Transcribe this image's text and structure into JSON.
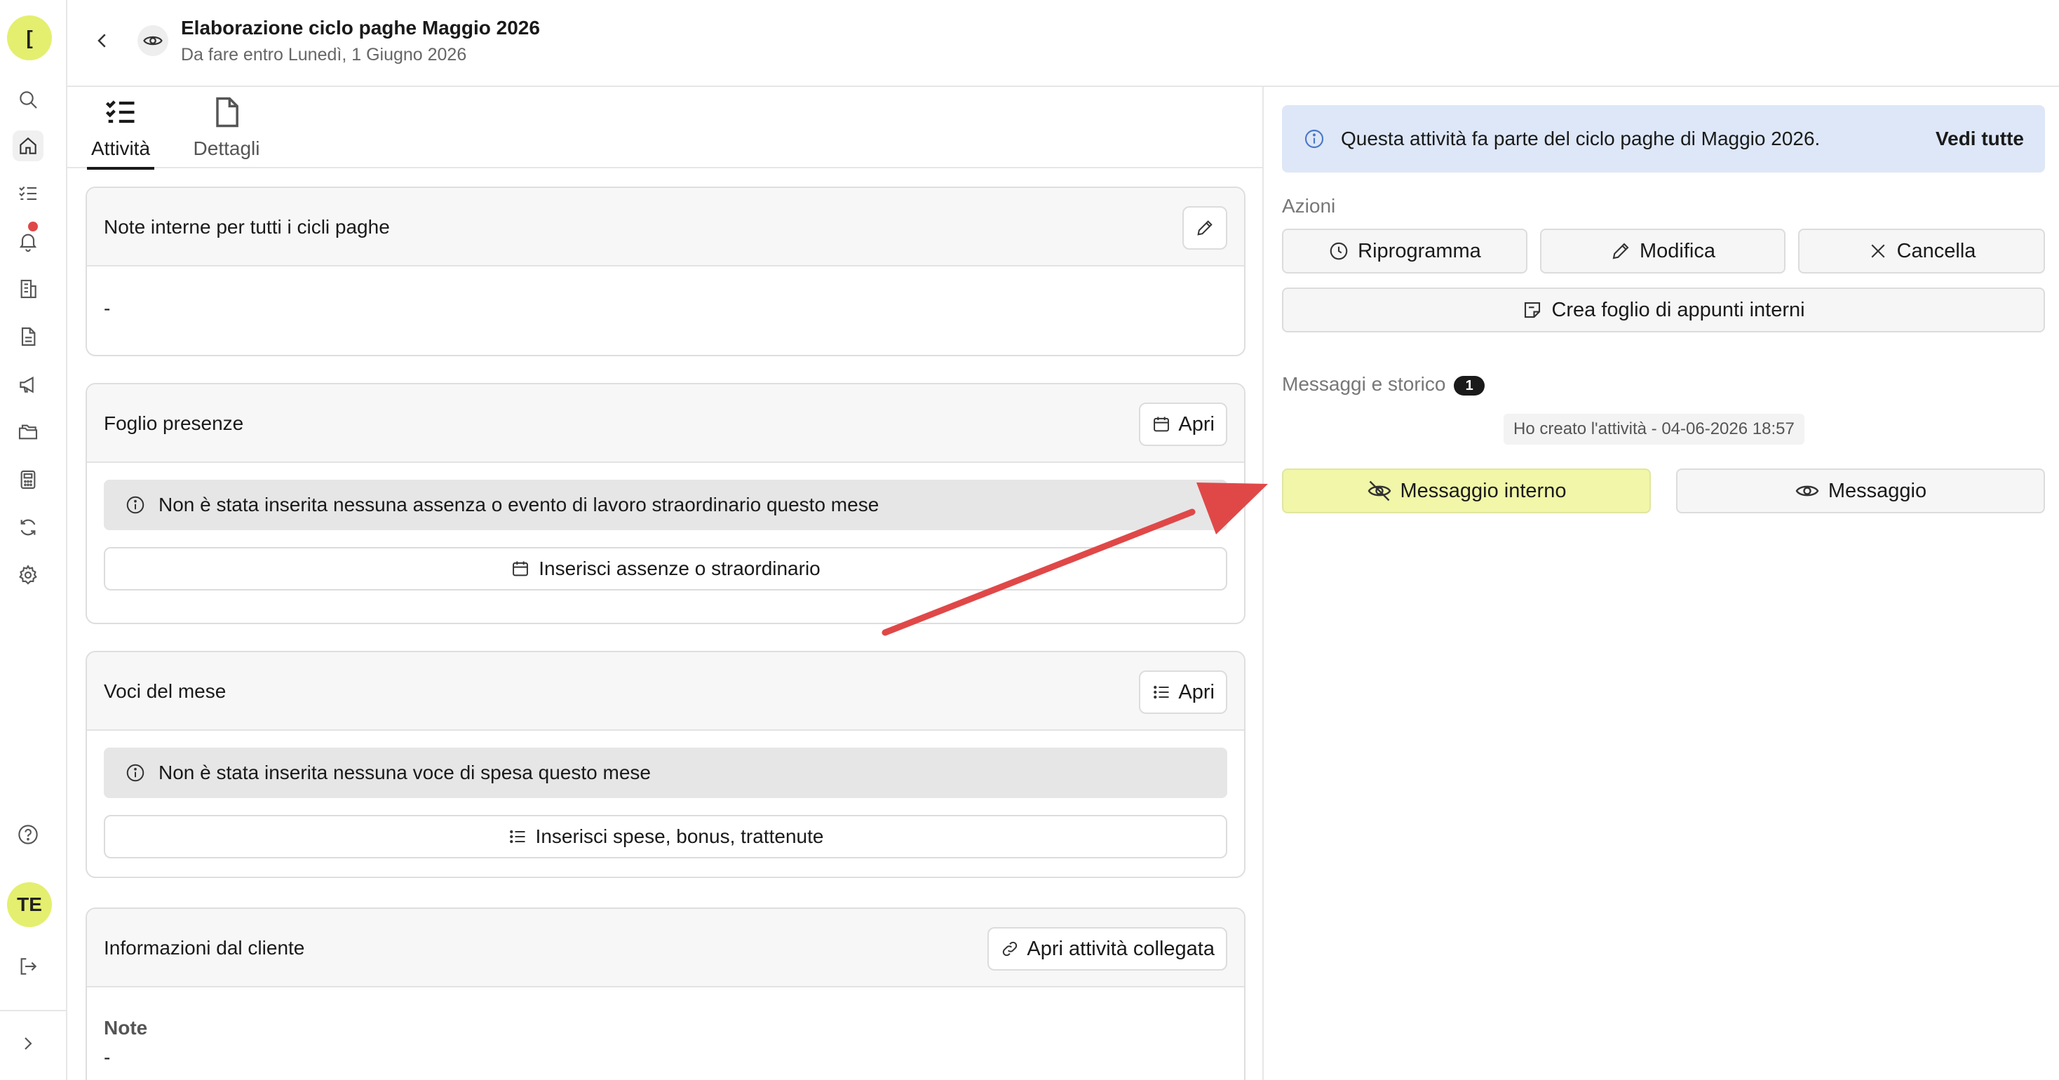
{
  "rail": {
    "workspace_initial": "[",
    "user_initials": "TE",
    "icons": [
      "search-icon",
      "home-icon",
      "tasks-icon",
      "bell-icon",
      "building-icon",
      "document-icon",
      "megaphone-icon",
      "folders-icon",
      "calculator-icon",
      "sync-icon",
      "gear-icon",
      "help-icon",
      "logout-icon",
      "expand-icon"
    ]
  },
  "header": {
    "title": "Elaborazione ciclo paghe Maggio 2026",
    "subtitle": "Da fare entro Lunedì, 1 Giugno 2026"
  },
  "tabs": [
    {
      "label": "Attività",
      "active": true
    },
    {
      "label": "Dettagli",
      "active": false
    }
  ],
  "cards": {
    "notes": {
      "title": "Note interne per tutti i cicli paghe",
      "value": "-"
    },
    "attendance": {
      "title": "Foglio presenze",
      "open_label": "Apri",
      "info": "Non è stata inserita nessuna assenza o evento di lavoro straordinario questo mese",
      "action": "Inserisci assenze o straordinario"
    },
    "items": {
      "title": "Voci del mese",
      "open_label": "Apri",
      "info": "Non è stata inserita nessuna voce di spesa questo mese",
      "action": "Inserisci spese, bonus, trattenute"
    },
    "client": {
      "title": "Informazioni dal cliente",
      "open_label": "Apri attività collegata",
      "note_label": "Note",
      "note_value": "-"
    }
  },
  "right": {
    "banner_text": "Questa attività fa parte del ciclo paghe di Maggio 2026.",
    "banner_link": "Vedi tutte",
    "actions_label": "Azioni",
    "reschedule": "Riprogramma",
    "edit": "Modifica",
    "cancel": "Cancella",
    "create_notes": "Crea foglio di appunti interni",
    "messages_label": "Messaggi e storico",
    "messages_count": "1",
    "history_item": "Ho creato l'attività - 04-06-2026 18:57",
    "internal_message": "Messaggio interno",
    "message": "Messaggio"
  },
  "colors": {
    "accent_yellow": "#e4ef6f",
    "internal_btn": "#f1f6a8",
    "banner_bg": "#dde7f7",
    "arrow": "#e04848"
  }
}
